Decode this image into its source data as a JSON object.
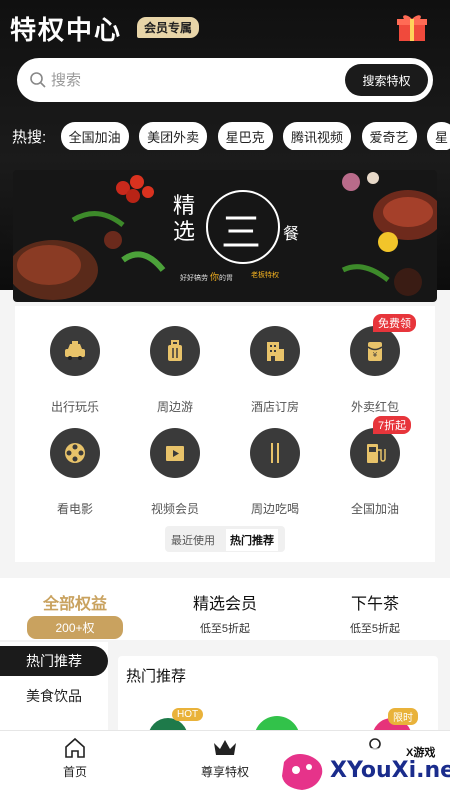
{
  "header": {
    "title": "特权中心",
    "badge": "会员专属"
  },
  "search": {
    "placeholder": "搜索",
    "button": "搜索特权"
  },
  "hot_search": {
    "label": "热搜:",
    "tags": [
      "全国加油",
      "美团外卖",
      "星巴克",
      "腾讯视频",
      "爱奇艺",
      "星"
    ]
  },
  "banner": {
    "title": "精选",
    "center": "三",
    "side": "餐",
    "slogan_a": "好好犒劳",
    "slogan_b": "你",
    "slogan_c": "的胃",
    "brand": "老板特权"
  },
  "grid": {
    "items": [
      {
        "label": "出行玩乐",
        "icon": "taxi-icon"
      },
      {
        "label": "周边游",
        "icon": "luggage-icon"
      },
      {
        "label": "酒店订房",
        "icon": "hotel-icon"
      },
      {
        "label": "外卖红包",
        "icon": "red-packet-icon",
        "tag": "免费领"
      },
      {
        "label": "看电影",
        "icon": "film-reel-icon"
      },
      {
        "label": "视频会员",
        "icon": "video-play-icon"
      },
      {
        "label": "周边吃喝",
        "icon": "chopsticks-icon"
      },
      {
        "label": "全国加油",
        "icon": "fuel-pump-icon",
        "tag": "7折起"
      }
    ]
  },
  "segment": {
    "recent": "最近使用",
    "hot": "热门推荐"
  },
  "tabs": [
    {
      "title": "全部权益",
      "sub": "200+权"
    },
    {
      "title": "精选会员",
      "sub": "低至5折起"
    },
    {
      "title": "下午茶",
      "sub": "低至5折起"
    }
  ],
  "leftnav": {
    "active": "热门推荐",
    "item": "美食饮品"
  },
  "panel": {
    "title": "热门推荐",
    "tag_hot": "HOT",
    "tag_limited": "限时"
  },
  "bottomnav": {
    "home": "首页",
    "privilege": "尊享特权",
    "mine": ""
  },
  "watermark": {
    "brand": "XYouXi.net",
    "small": "X游戏"
  },
  "colors": {
    "gold": "#c9a25f",
    "dark": "#1b1b1b",
    "red": "#e7353b"
  }
}
